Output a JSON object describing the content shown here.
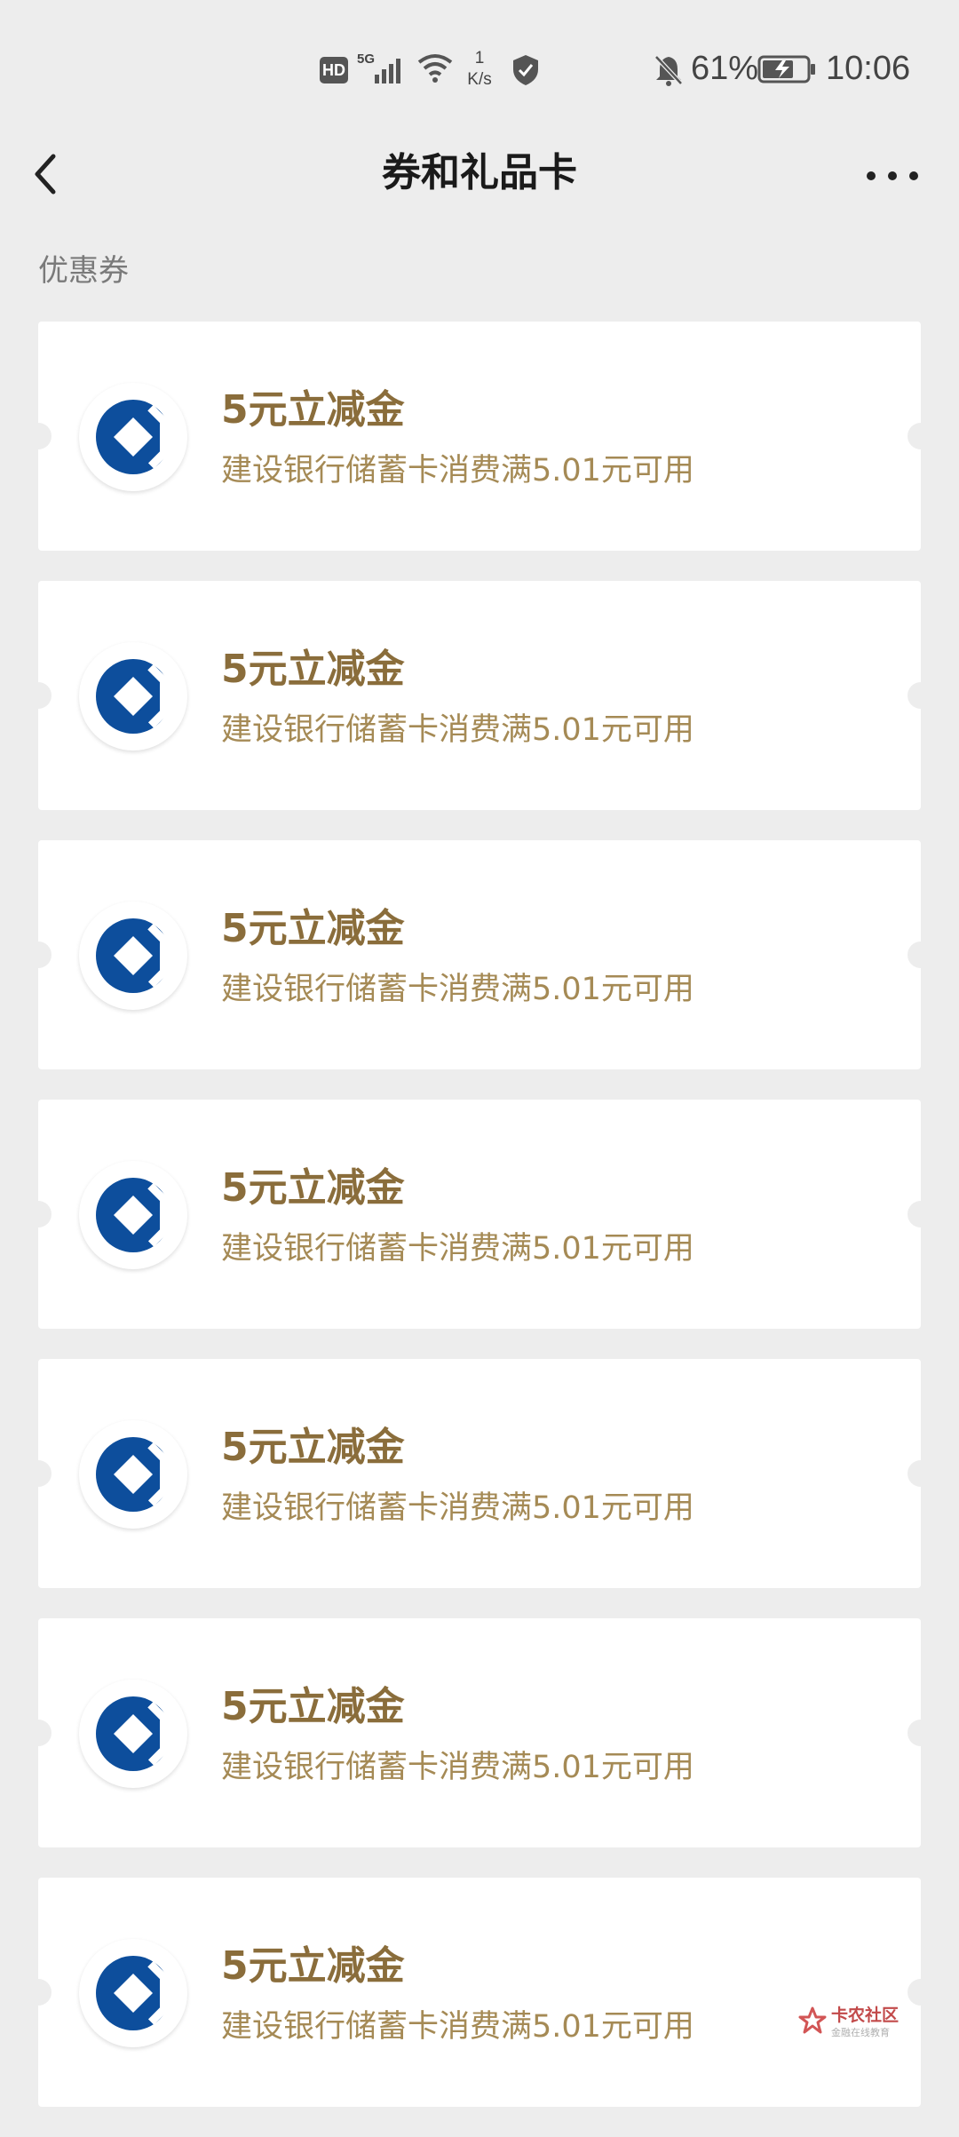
{
  "status_bar": {
    "hd": "HD",
    "network": "5G",
    "speed_value": "1",
    "speed_unit": "K/s",
    "battery_percent": "61%",
    "time": "10:06"
  },
  "header": {
    "title": "券和礼品卡"
  },
  "section": {
    "label": "优惠券"
  },
  "coupons": [
    {
      "title": "5元立减金",
      "desc": "建设银行储蓄卡消费满5.01元可用"
    },
    {
      "title": "5元立减金",
      "desc": "建设银行储蓄卡消费满5.01元可用"
    },
    {
      "title": "5元立减金",
      "desc": "建设银行储蓄卡消费满5.01元可用"
    },
    {
      "title": "5元立减金",
      "desc": "建设银行储蓄卡消费满5.01元可用"
    },
    {
      "title": "5元立减金",
      "desc": "建设银行储蓄卡消费满5.01元可用"
    },
    {
      "title": "5元立减金",
      "desc": "建设银行储蓄卡消费满5.01元可用"
    },
    {
      "title": "5元立减金",
      "desc": "建设银行储蓄卡消费满5.01元可用"
    }
  ],
  "watermark": {
    "main": "卡农社区",
    "sub": "金融在线教育"
  },
  "colors": {
    "background": "#ededed",
    "card": "#ffffff",
    "coupon_title": "#8a6d3b",
    "coupon_desc": "#a58a55",
    "bank_blue": "#0d4e9c"
  },
  "icons": {
    "back": "back-arrow-icon",
    "more": "more-dots-icon",
    "bank_logo": "ccb-logo-icon"
  }
}
